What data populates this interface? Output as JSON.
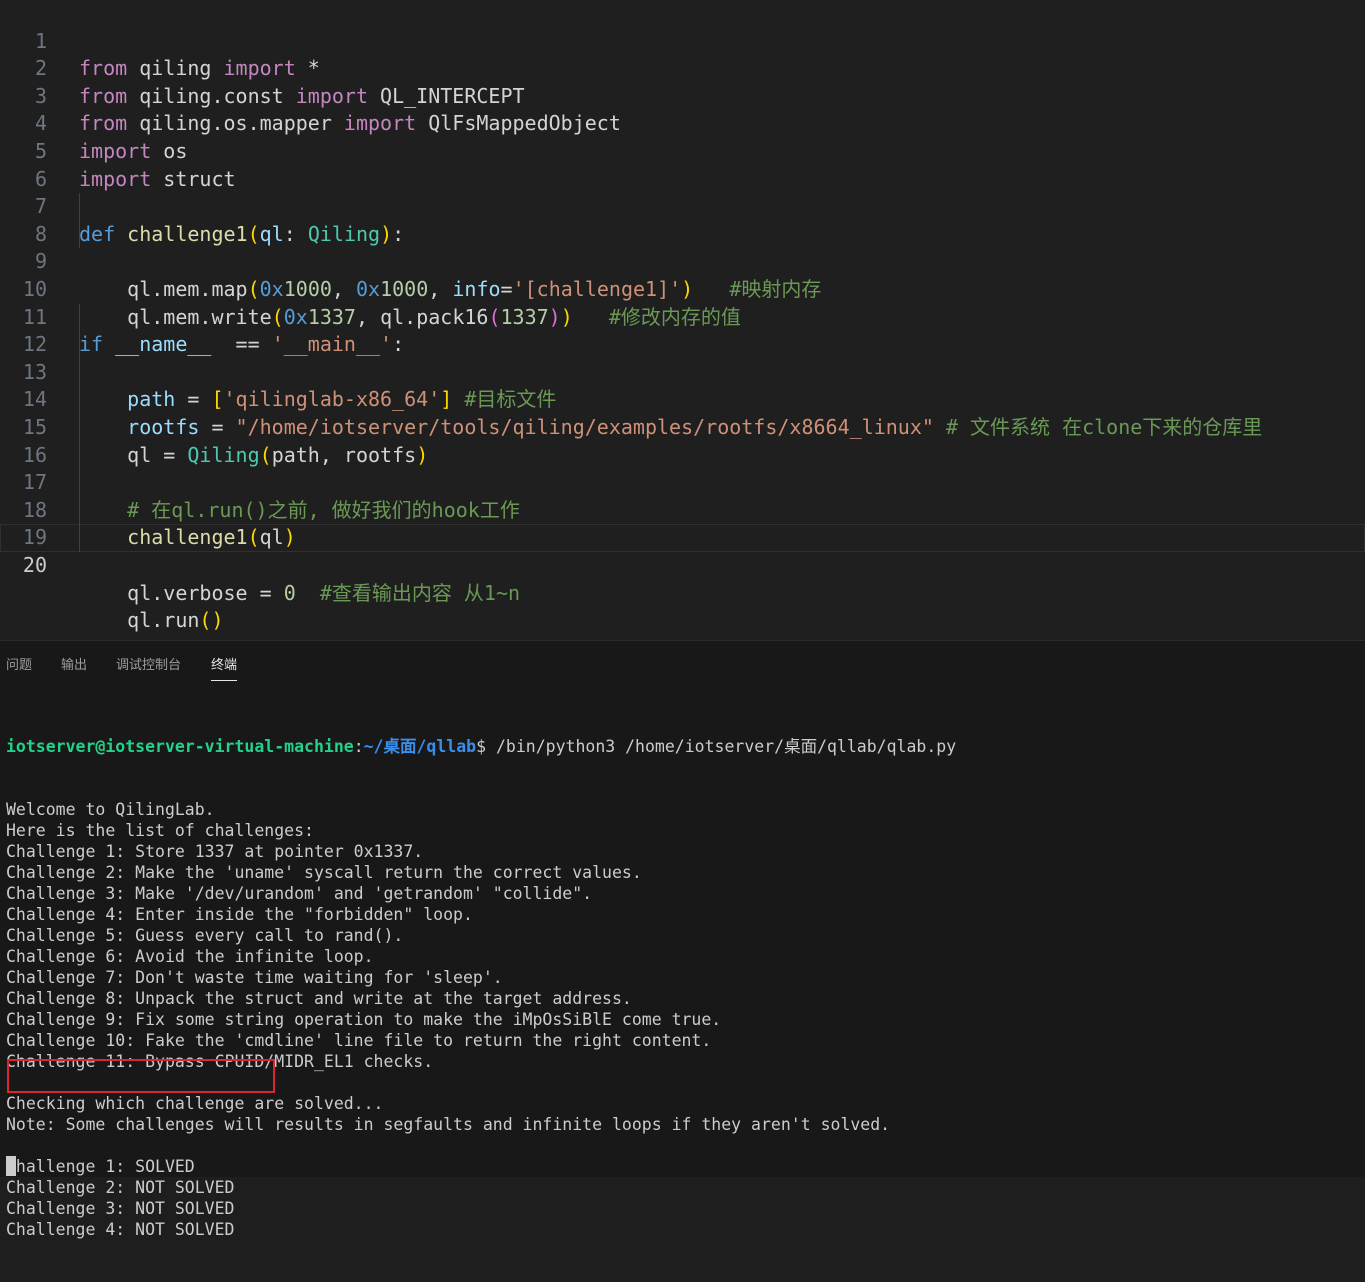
{
  "editor": {
    "line_numbers": [
      "1",
      "2",
      "3",
      "4",
      "5",
      "6",
      "7",
      "8",
      "9",
      "10",
      "11",
      "12",
      "13",
      "14",
      "15",
      "16",
      "17",
      "18",
      "19",
      "20"
    ],
    "active_line": "20",
    "tokens": {
      "from": "from",
      "import": "import",
      "def": "def",
      "if": "if",
      "star": " *",
      "mod_qiling": " qiling ",
      "mod_qiling_const": " qiling.const ",
      "mod_qiling_os_mapper": " qiling.os.mapper ",
      "ql_intercept": " QL_INTERCEPT",
      "qlfsmappedobject": " QlFsMappedObject",
      "os": " os",
      "struct": " struct",
      "challenge1": "challenge1",
      "ql": "ql",
      "colon_sp": ": ",
      "Qiling": "Qiling",
      "paren_open": "(",
      "paren_close": ")",
      "colon": ":",
      "ql_mem_map": "ql.mem.map",
      "hex_prefix": "0x",
      "n1000": "1000",
      "comma_sp": ", ",
      "info": "info",
      "eq": "=",
      "str_challenge1": "'[challenge1]'",
      "cmt_map": "   #映射内存",
      "ql_mem_write": "ql.mem.write",
      "n1337": "1337",
      "ql_pack16": "ql.pack16",
      "cmt_write": "   #修改内存的值",
      "dunder_name": "__name__",
      "eqeq": "  == ",
      "str_main": "'__main__'",
      "path": "path",
      "assign": " = ",
      "bracket_open": "[",
      "bracket_close": "]",
      "str_target": "'qilinglab-x86_64'",
      "cmt_target": " #目标文件",
      "rootfs": "rootfs",
      "str_rootfs": "\"/home/iotserver/tools/qiling/examples/rootfs/x8664_linux\"",
      "cmt_rootfs": " # 文件系统 在clone下来的仓库里",
      "ql_assign": "ql = ",
      "args_path_rootfs": "path, rootfs",
      "cmt_hook": "# 在ql.run()之前, 做好我们的hook工作",
      "ql_verbose": "ql.verbose",
      "zero": "0",
      "cmt_verbose": "  #查看输出内容 从1~n",
      "ql_run": "ql.run",
      "empty_parens": "()"
    }
  },
  "panel": {
    "tabs": [
      {
        "label": "问题"
      },
      {
        "label": "输出"
      },
      {
        "label": "调试控制台"
      },
      {
        "label": "终端",
        "active": true
      }
    ]
  },
  "terminal": {
    "prompt_user": "iotserver@iotserver-virtual-machine",
    "prompt_sep": ":",
    "prompt_path": "~/桌面/qllab",
    "prompt_symbol": "$ ",
    "command": "/bin/python3 /home/iotserver/桌面/qllab/qlab.py",
    "lines": [
      "Welcome to QilingLab.",
      "Here is the list of challenges:",
      "Challenge 1: Store 1337 at pointer 0x1337.",
      "Challenge 2: Make the 'uname' syscall return the correct values.",
      "Challenge 3: Make '/dev/urandom' and 'getrandom' \"collide\".",
      "Challenge 4: Enter inside the \"forbidden\" loop.",
      "Challenge 5: Guess every call to rand().",
      "Challenge 6: Avoid the infinite loop.",
      "Challenge 7: Don't waste time waiting for 'sleep'.",
      "Challenge 8: Unpack the struct and write at the target address.",
      "Challenge 9: Fix some string operation to make the iMpOsSiBlE come true.",
      "Challenge 10: Fake the 'cmdline' line file to return the right content.",
      "Challenge 11: Bypass CPUID/MIDR_EL1 checks.",
      "",
      "Checking which challenge are solved...",
      "Note: Some challenges will results in segfaults and infinite loops if they aren't solved.",
      "",
      "Challenge 1: SOLVED",
      "Challenge 2: NOT SOLVED",
      "Challenge 3: NOT SOLVED",
      "Challenge 4: NOT SOLVED"
    ]
  },
  "colors": {
    "editor_bg": "#1f1f1f",
    "panel_bg": "#181818",
    "keyword": "#c586c0",
    "function": "#dcdcaa",
    "string": "#ce9178",
    "comment": "#6a9955",
    "prompt_user": "#23d18b",
    "prompt_path": "#3b8eea",
    "highlight_border": "#d9272e"
  }
}
